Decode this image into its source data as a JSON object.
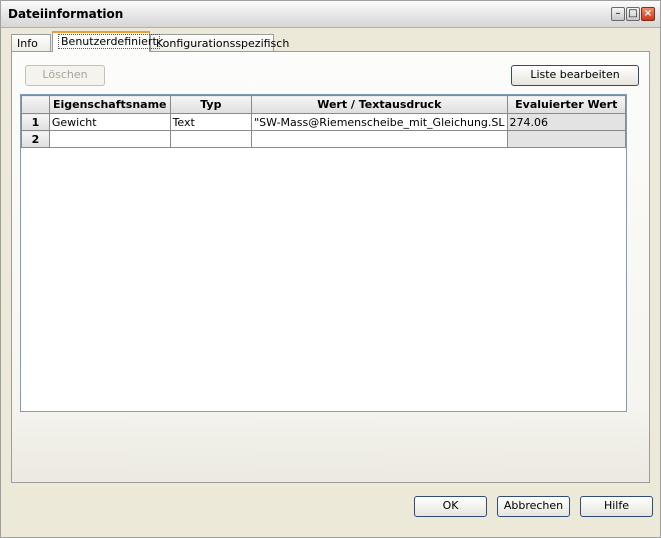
{
  "window": {
    "title": "Dateiinformation"
  },
  "tabs": [
    {
      "label": "Info"
    },
    {
      "label": "Benutzerdefiniert"
    },
    {
      "label": "Konfigurationsspezifisch"
    }
  ],
  "toolbar": {
    "delete_label": "Löschen",
    "edit_list_label": "Liste bearbeiten"
  },
  "table": {
    "columns": [
      "Eigenschaftsname",
      "Typ",
      "Wert / Textausdruck",
      "Evaluierter Wert"
    ],
    "rows": [
      {
        "num": "1",
        "name": "Gewicht",
        "type": "Text",
        "value": "\"SW-Mass@Riemenscheibe_mit_Gleichung.SL",
        "evaluated": "274.06"
      },
      {
        "num": "2",
        "name": "",
        "type": "",
        "value": "",
        "evaluated": ""
      }
    ]
  },
  "footer": {
    "ok_label": "OK",
    "cancel_label": "Abbrechen",
    "help_label": "Hilfe"
  }
}
